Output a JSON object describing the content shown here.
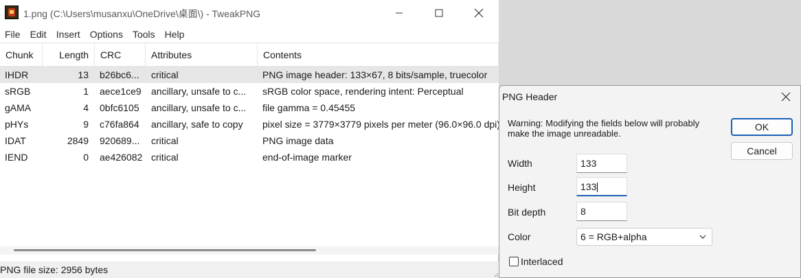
{
  "window": {
    "title": "1.png (C:\\Users\\musanxu\\OneDrive\\桌面\\) - TweakPNG"
  },
  "menu": [
    "File",
    "Edit",
    "Insert",
    "Options",
    "Tools",
    "Help"
  ],
  "table": {
    "columns": [
      "Chunk",
      "Length",
      "CRC",
      "Attributes",
      "Contents"
    ],
    "rows": [
      {
        "chunk": "IHDR",
        "length": "13",
        "crc": "b26bc6...",
        "attributes": "critical",
        "contents": "PNG image header: 133×67, 8 bits/sample, truecolor"
      },
      {
        "chunk": "sRGB",
        "length": "1",
        "crc": "aece1ce9",
        "attributes": "ancillary, unsafe to c...",
        "contents": "sRGB color space, rendering intent: Perceptual"
      },
      {
        "chunk": "gAMA",
        "length": "4",
        "crc": "0bfc6105",
        "attributes": "ancillary, unsafe to c...",
        "contents": "file gamma = 0.45455"
      },
      {
        "chunk": "pHYs",
        "length": "9",
        "crc": "c76fa864",
        "attributes": "ancillary, safe to copy",
        "contents": "pixel size = 3779×3779 pixels per meter (96.0×96.0 dpi)"
      },
      {
        "chunk": "IDAT",
        "length": "2849",
        "crc": "920689...",
        "attributes": "critical",
        "contents": "PNG image data"
      },
      {
        "chunk": "IEND",
        "length": "0",
        "crc": "ae426082",
        "attributes": "critical",
        "contents": "end-of-image marker"
      }
    ],
    "selected_row": 0
  },
  "status": "PNG file size: 2956 bytes",
  "dialog": {
    "title": "PNG Header",
    "warning": "Warning: Modifying the fields below will probably make the image unreadable.",
    "ok_label": "OK",
    "cancel_label": "Cancel",
    "width_label": "Width",
    "width_value": "133",
    "height_label": "Height",
    "height_value": "133",
    "bitdepth_label": "Bit depth",
    "bitdepth_value": "8",
    "color_label": "Color",
    "color_value": "6 = RGB+alpha",
    "interlaced_label": "Interlaced",
    "interlaced_checked": false
  },
  "colors": {
    "selection": "#e6e6e6",
    "accent": "#1a5fb4"
  }
}
